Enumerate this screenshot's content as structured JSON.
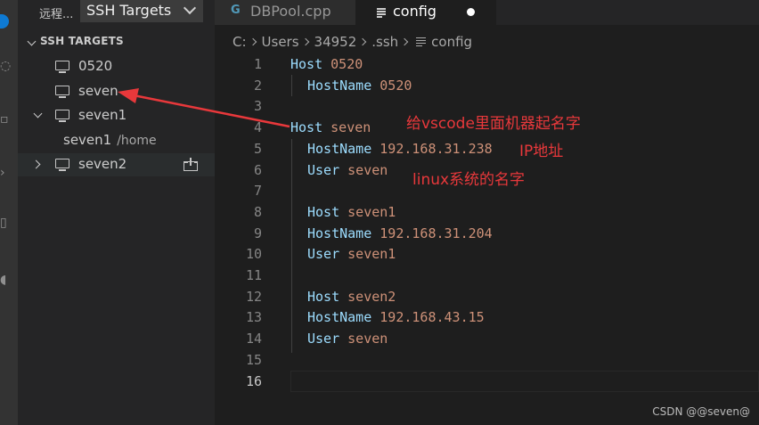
{
  "activity_bar": {
    "icons": [
      "remote-explorer-icon",
      "history-icon",
      "extensions-icon",
      "test-icon",
      "docker-icon",
      "live-share-icon"
    ],
    "badge_color": "#0e7ad3"
  },
  "sidebar": {
    "remote_label": "远程...",
    "target_type": "SSH Targets",
    "section_title": "SSH TARGETS",
    "hosts": [
      {
        "label": "0520"
      },
      {
        "label": "seven"
      },
      {
        "label": "seven1",
        "expanded": true,
        "child": {
          "label": "seven1",
          "path": "/home"
        }
      },
      {
        "label": "seven2",
        "expanded": false
      }
    ]
  },
  "editor": {
    "tabs": [
      {
        "label": "DBPool.cpp",
        "active": false,
        "icon": "cpp-file-icon"
      },
      {
        "label": "config",
        "active": true,
        "dirty": true,
        "icon": "text-file-icon"
      }
    ],
    "breadcrumb": [
      "C:",
      "Users",
      "34952",
      ".ssh",
      "config"
    ],
    "lines": [
      {
        "num": "1",
        "key": "Host",
        "value": "0520",
        "indent": false
      },
      {
        "num": "2",
        "key": "HostName",
        "value": "0520",
        "indent": true
      },
      {
        "num": "3",
        "key": "",
        "value": "",
        "indent": false
      },
      {
        "num": "4",
        "key": "Host",
        "value": "seven",
        "indent": false
      },
      {
        "num": "5",
        "key": "HostName",
        "value": "192.168.31.238",
        "indent": true
      },
      {
        "num": "6",
        "key": "User",
        "value": "seven",
        "indent": true
      },
      {
        "num": "7",
        "key": "",
        "value": "",
        "indent": false
      },
      {
        "num": "8",
        "key": "Host",
        "value": "seven1",
        "indent": true
      },
      {
        "num": "9",
        "key": "HostName",
        "value": "192.168.31.204",
        "indent": true
      },
      {
        "num": "10",
        "key": "User",
        "value": "seven1",
        "indent": true
      },
      {
        "num": "11",
        "key": "",
        "value": "",
        "indent": false
      },
      {
        "num": "12",
        "key": "Host",
        "value": "seven2",
        "indent": true
      },
      {
        "num": "13",
        "key": "HostName",
        "value": "192.168.43.15",
        "indent": true
      },
      {
        "num": "14",
        "key": "User",
        "value": "seven",
        "indent": true
      },
      {
        "num": "15",
        "key": "",
        "value": "",
        "indent": false
      },
      {
        "num": "16",
        "key": "",
        "value": "",
        "indent": false
      }
    ],
    "active_line": "16"
  },
  "annotations": {
    "name_note": "给vscode里面机器起名字",
    "ip_note": "IP地址",
    "user_note": "linux系统的名字",
    "color": "#e8383b"
  },
  "watermark": "CSDN @@seven@"
}
